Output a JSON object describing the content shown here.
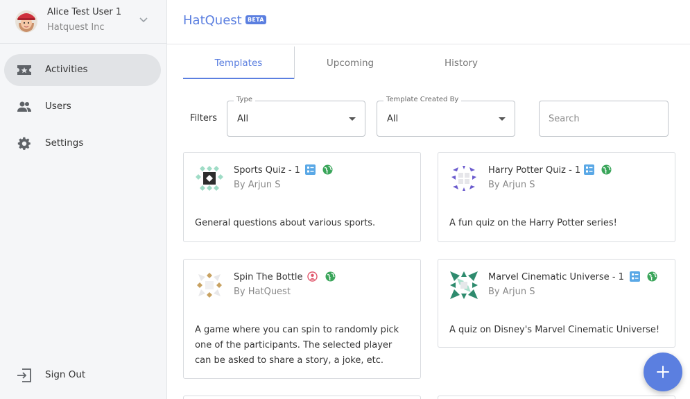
{
  "user": {
    "name": "Alice Test User 1",
    "org": "Hatquest Inc"
  },
  "sidebar": {
    "items": [
      {
        "label": "Activities",
        "icon": "ticket-star-icon",
        "active": true
      },
      {
        "label": "Users",
        "icon": "people-icon",
        "active": false
      },
      {
        "label": "Settings",
        "icon": "gear-icon",
        "active": false
      }
    ],
    "signout": {
      "label": "Sign Out",
      "icon": "sign-out-icon"
    }
  },
  "brand": {
    "name": "HatQuest",
    "badge": "BETA",
    "color": "#5b7fe0"
  },
  "tabs": [
    {
      "label": "Templates",
      "active": true
    },
    {
      "label": "Upcoming",
      "active": false
    },
    {
      "label": "History",
      "active": false
    }
  ],
  "filters": {
    "label": "Filters",
    "type": {
      "legend": "Type",
      "value": "All"
    },
    "created_by": {
      "legend": "Template Created By",
      "value": "All"
    },
    "search": {
      "placeholder": "Search",
      "value": ""
    }
  },
  "cards": [
    {
      "title": "Sports Quiz - 1",
      "author": "By Arjun S",
      "description": "General questions about various sports.",
      "badges": [
        "quiz-icon",
        "globe-icon"
      ]
    },
    {
      "title": "Harry Potter Quiz - 1",
      "author": "By Arjun S",
      "description": "A fun quiz on the Harry Potter series!",
      "badges": [
        "quiz-icon",
        "globe-icon"
      ]
    },
    {
      "title": "Spin The Bottle",
      "author": "By HatQuest",
      "description": "A game where you can spin to randomly pick one of the participants. The selected player can be asked to share a story, a joke, etc.",
      "badges": [
        "person-icon",
        "globe-icon"
      ]
    },
    {
      "title": "Marvel Cinematic Universe - 1",
      "author": "By Arjun S",
      "description": "A quiz on Disney's Marvel Cinematic Universe!",
      "badges": [
        "quiz-icon",
        "globe-icon"
      ]
    }
  ],
  "colors": {
    "accent": "#5b7fe0",
    "quiz_badge": "#5aa8e6",
    "globe_badge": "#3aa55a",
    "person_badge": "#e0566b"
  },
  "fab": {
    "icon": "plus-icon"
  }
}
